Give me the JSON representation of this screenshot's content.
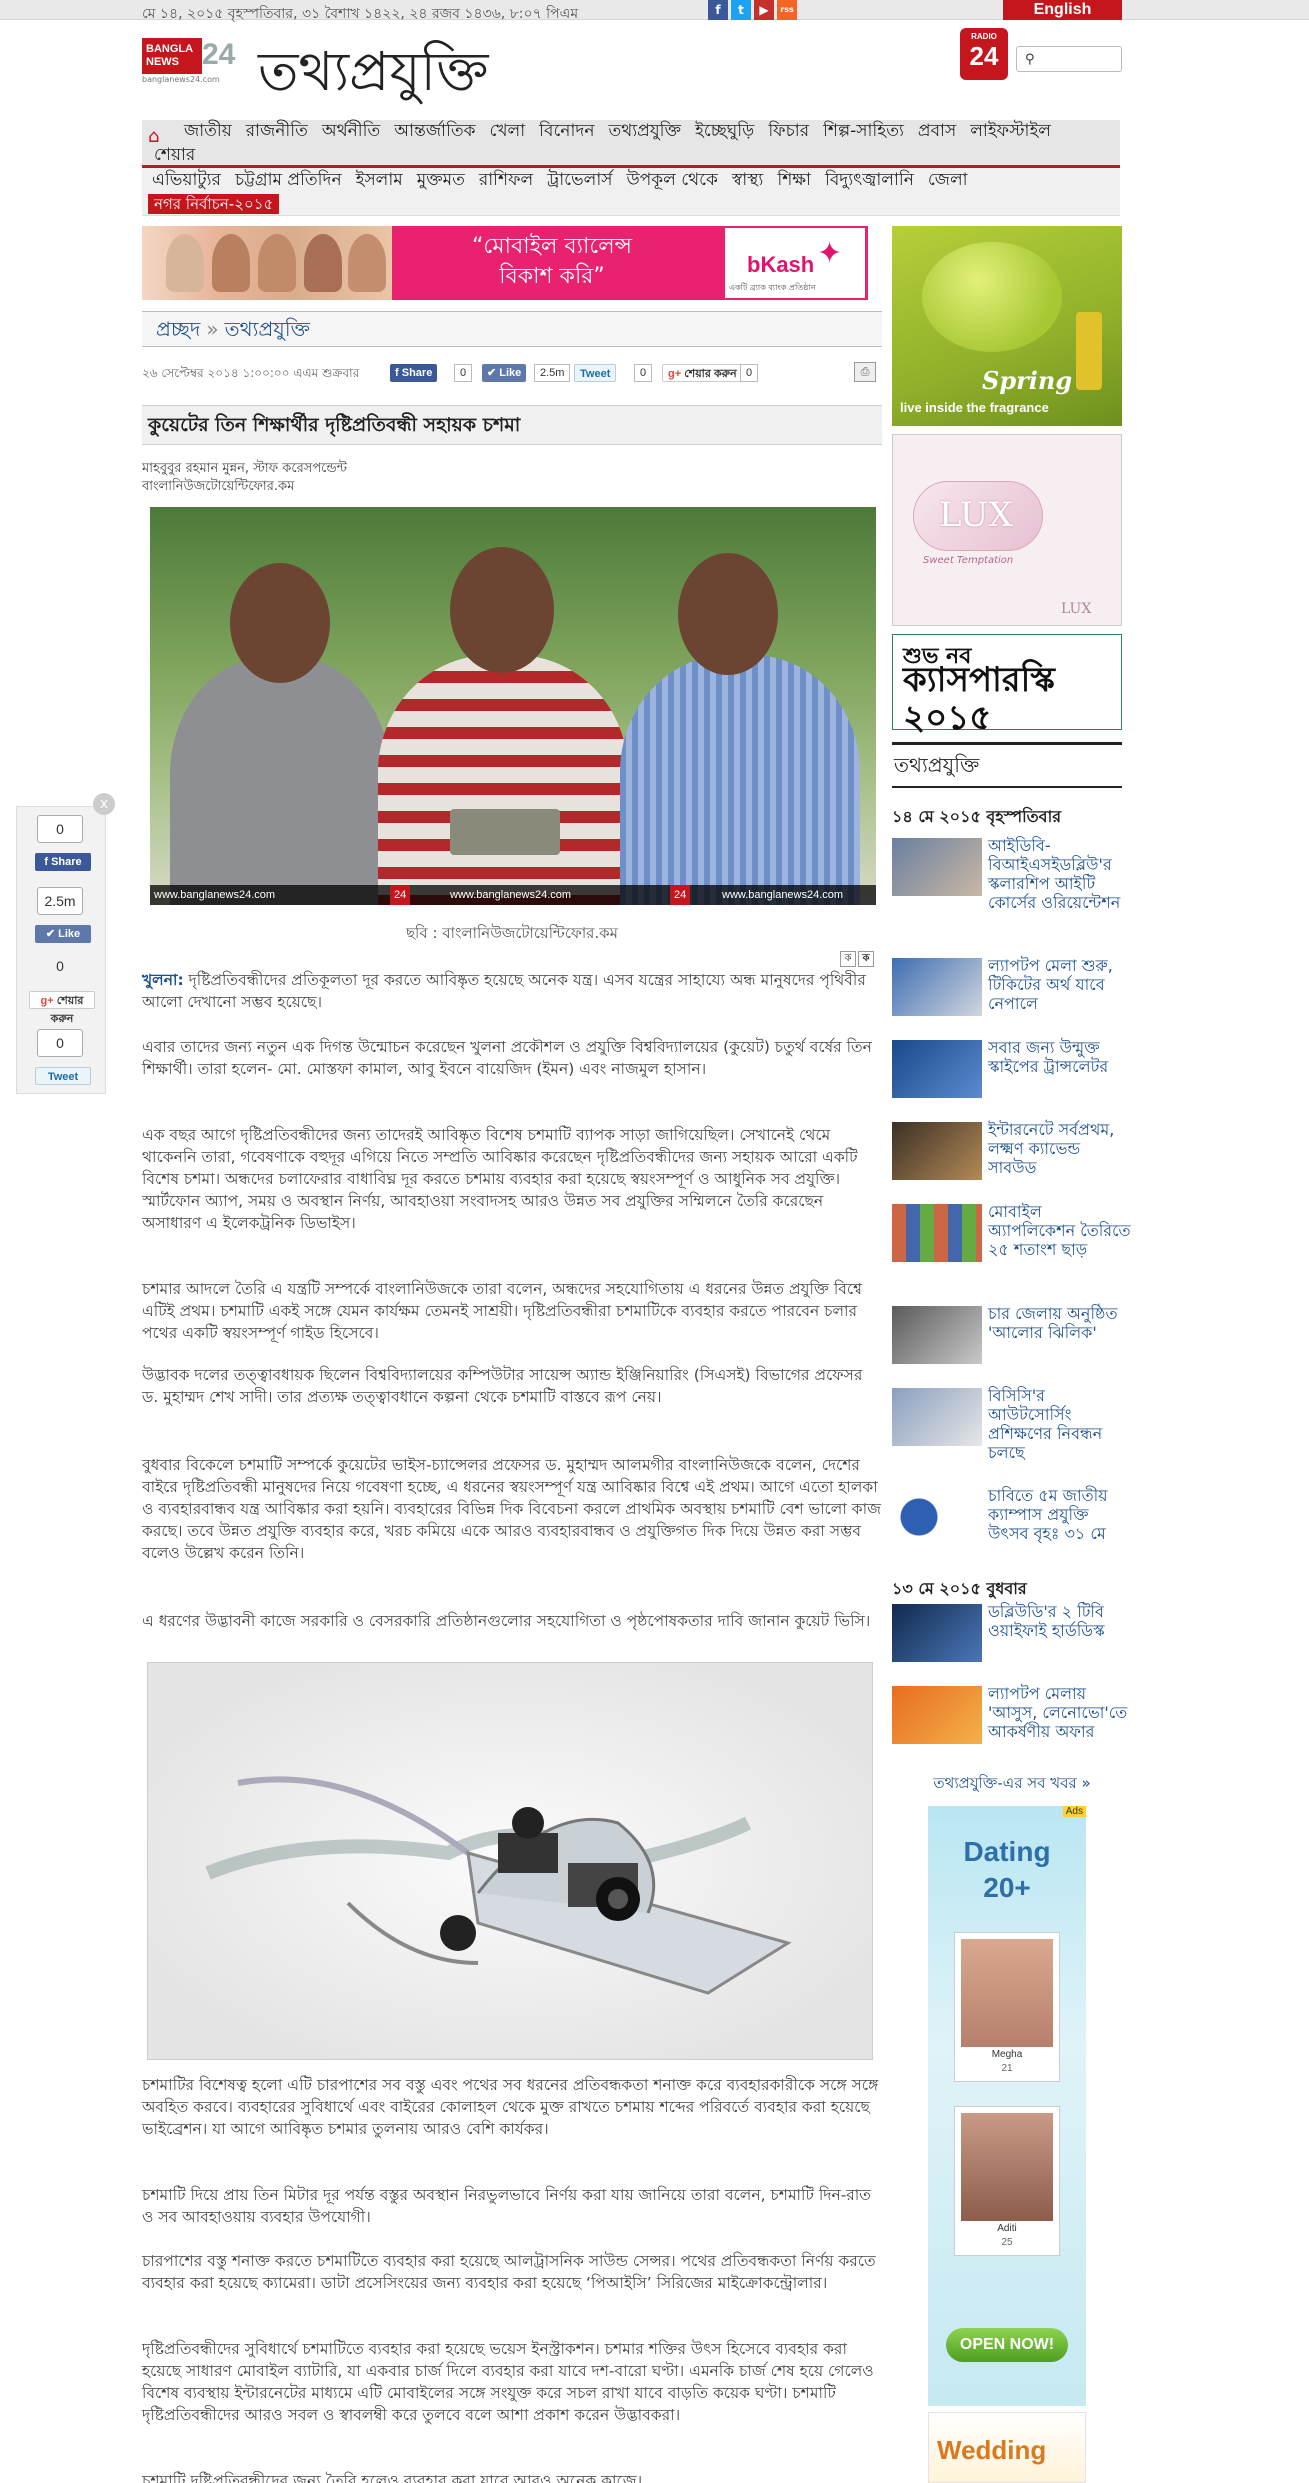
{
  "topbar": {
    "date": "মে ১৪, ২০১৫ বৃহস্পতিবার, ৩১ বৈশাখ ১৪২২, ২৪ রজব ১৪৩৬, ৮:০৭ পিএম",
    "english_label": "English",
    "social": [
      "f",
      "t",
      "▶",
      "rss"
    ]
  },
  "header": {
    "logo_text": "BANGLA NEWS",
    "logo_num": "24",
    "logo_site": "banglanews24.com",
    "section_title": "তথ্যপ্রযুক্তি",
    "radio_top": "RADIO",
    "radio_num": "24"
  },
  "nav": {
    "primary": [
      "জাতীয়",
      "রাজনীতি",
      "অর্থনীতি",
      "আন্তর্জাতিক",
      "খেলা",
      "বিনোদন",
      "তথ্যপ্রযুক্তি",
      "ইচ্ছেঘুড়ি",
      "ফিচার",
      "শিল্প-সাহিত্য",
      "প্রবাস",
      "লাইফস্টাইল"
    ],
    "primary_wrap": "শেয়ার",
    "secondary": [
      "এভিয়াট্যুর",
      "চট্টগ্রাম প্রতিদিন",
      "ইসলাম",
      "মুক্তমত",
      "রাশিফল",
      "ট্রাভেলার্স",
      "উপকূল থেকে",
      "স্বাস্থ্য",
      "শিক্ষা",
      "বিদ্যুৎজ্বালানি",
      "জেলা"
    ],
    "election": "নগর নির্বাচন-২০১৫"
  },
  "banner": {
    "message": "“মোবাইল ব্যালেন্স বিকাশ করি”",
    "brand": "bKash",
    "brand_sub": "একটি ব্র্যাক ব্যাংক প্রতিষ্ঠান"
  },
  "breadcrumb": {
    "home": "প্রচ্ছদ",
    "current": "তথ্যপ্রযুক্তি"
  },
  "share": {
    "published": "২৬ সেপ্টেম্বর ২০১৪ ১:০০:০০ এএম শুক্রবার",
    "share_label": "Share",
    "share_count": "0",
    "like_label": "Like",
    "like_count": "2.5m",
    "tweet_label": "Tweet",
    "tweet_count": "0",
    "gplus_label": "শেয়ার করুন",
    "gplus_count": "0"
  },
  "article": {
    "headline": "কুয়েটের তিন শিক্ষার্থীর দৃষ্টিপ্রতিবন্ধী সহায়ক চশমা",
    "byline1": "মাহবুবুর রহমান মুন্নন, স্টাফ করেসপন্ডেন্ট",
    "byline2": "বাংলানিউজটোয়েন্টিফোর.কম",
    "photo_watermark": "www.banglanews24.com",
    "caption": "ছবি : বাংলানিউজটোয়েন্টিফোর.কম",
    "lead_label": "খুলনা:",
    "p1": " দৃষ্টিপ্রতিবন্ধীদের প্রতিকূলতা দূর করতে আবিষ্কৃত হয়েছে অনেক যন্ত্র। এসব যন্ত্রের সাহায্যে অন্ধ মানুষদের পৃথিবীর আলো দেখানো সম্ভব হয়েছে।",
    "p2": "এবার তাদের জন্য নতুন এক দিগন্ত উন্মোচন করেছেন খুলনা প্রকৌশল ও প্রযুক্তি বিশ্ববিদ্যালয়ের (কুয়েট) চতুর্থ বর্ষের তিন শিক্ষার্থী। তারা হলেন- মো. মোস্তফা কামাল, আবু ইবনে বায়েজিদ (ইমন) এবং নাজমুল হাসান।",
    "p3": "এক বছর আগে দৃষ্টিপ্রতিবন্ধীদের জন্য তাদেরই আবিষ্কৃত বিশেষ চশমাটি ব্যাপক সাড়া জাগিয়েছিল। সেখানেই থেমে থাকেননি তারা, গবেষণাকে বহুদূর এগিয়ে নিতে সম্প্রতি আবিষ্কার করেছেন দৃষ্টিপ্রতিবন্ধীদের জন্য সহায়ক আরো একটি বিশেষ চশমা। অন্ধদের চলাফেরার বাধাবিঘ্ন দূর করতে চশমায় ব্যবহার করা হয়েছে স্বয়ংসম্পূর্ণ ও আধুনিক সব প্রযুক্তি। স্মার্টফোন অ্যাপ, সময় ও অবস্থান নির্ণয়, আবহাওয়া সংবাদসহ আরও উন্নত সব প্রযুক্তির সম্মিলনে তৈরি করেছেন অসাধারণ এ ইলেকট্রনিক ডিভাইস।",
    "p4": "চশমার আদলে তৈরি এ যন্ত্রটি সম্পর্কে বাংলানিউজকে তারা বলেন, অন্ধদের সহযোগিতায় এ ধরনের উন্নত প্রযুক্তি বিশ্বে এটিই প্রথম। চশমাটি একই সঙ্গে যেমন কার্যক্ষম তেমনই সাশ্রয়ী। দৃষ্টিপ্রতিবন্ধীরা চশমাটিকে ব্যবহার করতে পারবেন চলার পথের একটি স্বয়ংসম্পূর্ণ গাইড হিসেবে।",
    "p5": "উদ্ভাবক দলের তত্ত্বাবধায়ক ছিলেন বিশ্ববিদ্যালয়ের কম্পিউটার সায়েন্স অ্যান্ড ইঞ্জিনিয়ারিং (সিএসই) বিভাগের প্রফেসর ড. মুহাম্মদ শেখ সাদী। তার প্রত্যক্ষ তত্ত্বাবধানে কল্পনা থেকে চশমাটি বাস্তবে রূপ নেয়।",
    "p6": "বুধবার বিকেলে চশমাটি সম্পর্কে কুয়েটের ভাইস-চ্যান্সেলর প্রফেসর ড. মুহাম্মদ আলমগীর বাংলানিউজকে বলেন, দেশের বাইরে দৃষ্টিপ্রতিবন্ধী মানুষদের নিয়ে গবেষণা হচ্ছে, এ ধরনের স্বয়ংসম্পূর্ণ যন্ত্র আবিষ্কার বিশ্বে এই প্রথম। আগে এতো হালকা ও ব্যবহারবান্ধব যন্ত্র আবিষ্কার করা হয়নি। ব্যবহারের বিভিন্ন দিক বিবেচনা করলে প্রাথমিক অবস্থায় চশমাটি বেশ ভালো কাজ করছে। তবে উন্নত প্রযুক্তি ব্যবহার করে, খরচ কমিয়ে একে আরও ব্যবহারবান্ধব ও প্রযুক্তিগত দিক দিয়ে উন্নত করা সম্ভব বলেও উল্লেখ করেন তিনি।",
    "p7": "এ ধরণের উদ্ভাবনী কাজে সরকারি ও বেসরকারি প্রতিষ্ঠানগুলোর সহযোগিতা ও পৃষ্ঠপোষকতার দাবি জানান কুয়েট ভিসি।",
    "p8": "চশমাটির বিশেষত্ব হলো এটি চারপাশের সব বস্তু এবং পথের সব ধরনের প্রতিবন্ধকতা শনাক্ত করে ব্যবহারকারীকে সঙ্গে সঙ্গে অবহিত করবে। ব্যবহারের সুবিধার্থে এবং বাইরের কোলাহল থেকে মুক্ত রাখতে চশমায় শব্দের পরিবর্তে ব্যবহার করা হয়েছে ভাইব্রেশন। যা আগে আবিষ্কৃত চশমার তুলনায় আরও বেশি কার্যকর।",
    "p9": "চশমাটি দিয়ে প্রায় তিন মিটার দূর পর্যন্ত বস্তুর অবস্থান নিরভুলভাবে নির্ণয় করা যায় জানিয়ে তারা বলেন, চশমাটি দিন-রাত ও সব আবহাওয়ায় ব্যবহার উপযোগী।",
    "p10": "চারপাশের বস্তু শনাক্ত করতে চশমাটিতে ব্যবহার করা হয়েছে আলট্রাসনিক সাউন্ড সেন্সর। পথের প্রতিবন্ধকতা নির্ণয় করতে ব্যবহার করা হয়েছে ক্যামেরা। ডাটা প্রসেসিংয়ের জন্য ব্যবহার করা হয়েছে ‘পিআইসি’ সিরিজের মাইক্রোকন্ট্রোলার।",
    "p11": "দৃষ্টিপ্রতিবন্ধীদের সুবিধার্থে চশমাটিতে ব্যবহার করা হয়েছে ভয়েস ইনস্ট্রাকশন। চশমার শক্তির উৎস হিসেবে ব্যবহার করা হয়েছে সাধারণ মোবাইল ব্যাটারি, যা একবার চার্জ দিলে ব্যবহার করা যাবে দশ-বারো ঘণ্টা। এমনকি চার্জ শেষ হয়ে গেলেও বিশেষ ব্যবস্থায় ইন্টারনেটের মাধ্যমে এটি মোবাইলের সঙ্গে সংযুক্ত করে সচল রাখা যাবে বাড়তি কয়েক ঘণ্টা। চশমাটি দৃষ্টিপ্রতিবন্ধীদের আরও সবল ও স্বাবলম্বী করে তুলবে বলে আশা প্রকাশ করেন উদ্ভাবকরা।",
    "p12": "চশমাটি দৃষ্টিপ্রতিবন্ধীদের জন্য তৈরি হলেও ব্যবহার করা যাবে আরও অনেক কাজে।"
  },
  "float_share": {
    "close": "x",
    "share_count": "0",
    "share_label": "Share",
    "like_count": "2.5m",
    "like_label": "Like",
    "gplus_count": "0",
    "gplus_label": "শেয়ার করুন",
    "tweet_count": "0",
    "tweet_label": "Tweet"
  },
  "ads": {
    "spring_tagline": "live inside the fragrance",
    "spring_brand": "Spring",
    "lux_brand": "LUX",
    "lux_sub": "Sweet Temptation",
    "casper_line1": "শুভ নব",
    "casper_line2": "ক্যাসপারস্কি ২০১৫",
    "dating_line1": "Dating",
    "dating_line2": "20+",
    "dating_profiles": [
      {
        "name": "Megha",
        "age": "21"
      },
      {
        "name": "Aditi",
        "age": "25"
      }
    ],
    "dating_cta": "OPEN NOW!",
    "dating_ads_tag": "Ads",
    "wedding": "Wedding"
  },
  "sidebar": {
    "title": "তথ্যপ্রযুক্তি",
    "date1": "১৪ মে ২০১৫ বৃহস্পতিবার",
    "items_day1": [
      "আইডিবি-বিআইএসইডব্লিউ'র স্কলারশিপ আইটি কোর্সের ওরিয়েন্টেশন",
      "ল্যাপটপ মেলা শুরু, টিকিটের অর্থ যাবে নেপালে",
      "সবার জন্য উন্মুক্ত স্কাইপের ট্রান্সলেটর",
      "ইন্টারনেটে সর্বপ্রথম, লক্ষ্মণ ক্যাভেন্ড সাবউড",
      "মোবাইল অ্যাপলিকেশন তৈরিতে ২৫ শতাংশ ছাড়",
      "চার জেলায় অনুষ্ঠিত 'আলোর ঝিলিক'",
      "বিসিসি'র আউটসোর্সিং প্রশিক্ষণের নিবন্ধন চলছে",
      "চাবিতে ৫ম জাতীয় ক্যাম্পাস প্রযুক্তি উৎসব বৃহঃ ৩১ মে"
    ],
    "date2": "১৩ মে ২০১৫ বুধবার",
    "items_day2": [
      "ডব্লিউডি'র ২ টিবি ওয়াইফাই হার্ডডিস্ক",
      "ল্যাপটপ মেলায় 'আসুস, লেনোভো'তে আকর্ষণীয় অফার"
    ],
    "more": "তথ্যপ্রযুক্তি-এর সব খবর »"
  }
}
